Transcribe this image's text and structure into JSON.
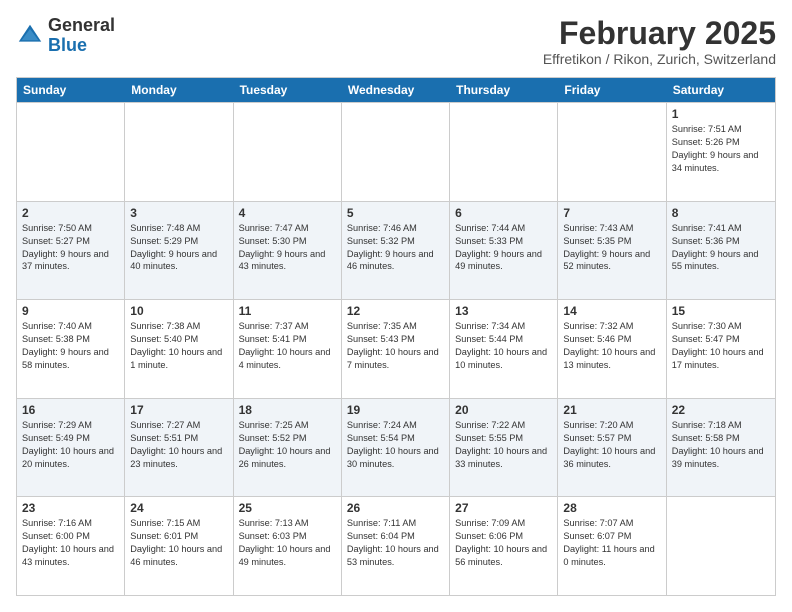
{
  "logo": {
    "general": "General",
    "blue": "Blue"
  },
  "header": {
    "title": "February 2025",
    "location": "Effretikon / Rikon, Zurich, Switzerland"
  },
  "days_of_week": [
    "Sunday",
    "Monday",
    "Tuesday",
    "Wednesday",
    "Thursday",
    "Friday",
    "Saturday"
  ],
  "weeks": [
    [
      {
        "day": "",
        "info": ""
      },
      {
        "day": "",
        "info": ""
      },
      {
        "day": "",
        "info": ""
      },
      {
        "day": "",
        "info": ""
      },
      {
        "day": "",
        "info": ""
      },
      {
        "day": "",
        "info": ""
      },
      {
        "day": "1",
        "info": "Sunrise: 7:51 AM\nSunset: 5:26 PM\nDaylight: 9 hours and 34 minutes."
      }
    ],
    [
      {
        "day": "2",
        "info": "Sunrise: 7:50 AM\nSunset: 5:27 PM\nDaylight: 9 hours and 37 minutes."
      },
      {
        "day": "3",
        "info": "Sunrise: 7:48 AM\nSunset: 5:29 PM\nDaylight: 9 hours and 40 minutes."
      },
      {
        "day": "4",
        "info": "Sunrise: 7:47 AM\nSunset: 5:30 PM\nDaylight: 9 hours and 43 minutes."
      },
      {
        "day": "5",
        "info": "Sunrise: 7:46 AM\nSunset: 5:32 PM\nDaylight: 9 hours and 46 minutes."
      },
      {
        "day": "6",
        "info": "Sunrise: 7:44 AM\nSunset: 5:33 PM\nDaylight: 9 hours and 49 minutes."
      },
      {
        "day": "7",
        "info": "Sunrise: 7:43 AM\nSunset: 5:35 PM\nDaylight: 9 hours and 52 minutes."
      },
      {
        "day": "8",
        "info": "Sunrise: 7:41 AM\nSunset: 5:36 PM\nDaylight: 9 hours and 55 minutes."
      }
    ],
    [
      {
        "day": "9",
        "info": "Sunrise: 7:40 AM\nSunset: 5:38 PM\nDaylight: 9 hours and 58 minutes."
      },
      {
        "day": "10",
        "info": "Sunrise: 7:38 AM\nSunset: 5:40 PM\nDaylight: 10 hours and 1 minute."
      },
      {
        "day": "11",
        "info": "Sunrise: 7:37 AM\nSunset: 5:41 PM\nDaylight: 10 hours and 4 minutes."
      },
      {
        "day": "12",
        "info": "Sunrise: 7:35 AM\nSunset: 5:43 PM\nDaylight: 10 hours and 7 minutes."
      },
      {
        "day": "13",
        "info": "Sunrise: 7:34 AM\nSunset: 5:44 PM\nDaylight: 10 hours and 10 minutes."
      },
      {
        "day": "14",
        "info": "Sunrise: 7:32 AM\nSunset: 5:46 PM\nDaylight: 10 hours and 13 minutes."
      },
      {
        "day": "15",
        "info": "Sunrise: 7:30 AM\nSunset: 5:47 PM\nDaylight: 10 hours and 17 minutes."
      }
    ],
    [
      {
        "day": "16",
        "info": "Sunrise: 7:29 AM\nSunset: 5:49 PM\nDaylight: 10 hours and 20 minutes."
      },
      {
        "day": "17",
        "info": "Sunrise: 7:27 AM\nSunset: 5:51 PM\nDaylight: 10 hours and 23 minutes."
      },
      {
        "day": "18",
        "info": "Sunrise: 7:25 AM\nSunset: 5:52 PM\nDaylight: 10 hours and 26 minutes."
      },
      {
        "day": "19",
        "info": "Sunrise: 7:24 AM\nSunset: 5:54 PM\nDaylight: 10 hours and 30 minutes."
      },
      {
        "day": "20",
        "info": "Sunrise: 7:22 AM\nSunset: 5:55 PM\nDaylight: 10 hours and 33 minutes."
      },
      {
        "day": "21",
        "info": "Sunrise: 7:20 AM\nSunset: 5:57 PM\nDaylight: 10 hours and 36 minutes."
      },
      {
        "day": "22",
        "info": "Sunrise: 7:18 AM\nSunset: 5:58 PM\nDaylight: 10 hours and 39 minutes."
      }
    ],
    [
      {
        "day": "23",
        "info": "Sunrise: 7:16 AM\nSunset: 6:00 PM\nDaylight: 10 hours and 43 minutes."
      },
      {
        "day": "24",
        "info": "Sunrise: 7:15 AM\nSunset: 6:01 PM\nDaylight: 10 hours and 46 minutes."
      },
      {
        "day": "25",
        "info": "Sunrise: 7:13 AM\nSunset: 6:03 PM\nDaylight: 10 hours and 49 minutes."
      },
      {
        "day": "26",
        "info": "Sunrise: 7:11 AM\nSunset: 6:04 PM\nDaylight: 10 hours and 53 minutes."
      },
      {
        "day": "27",
        "info": "Sunrise: 7:09 AM\nSunset: 6:06 PM\nDaylight: 10 hours and 56 minutes."
      },
      {
        "day": "28",
        "info": "Sunrise: 7:07 AM\nSunset: 6:07 PM\nDaylight: 11 hours and 0 minutes."
      },
      {
        "day": "",
        "info": ""
      }
    ]
  ]
}
